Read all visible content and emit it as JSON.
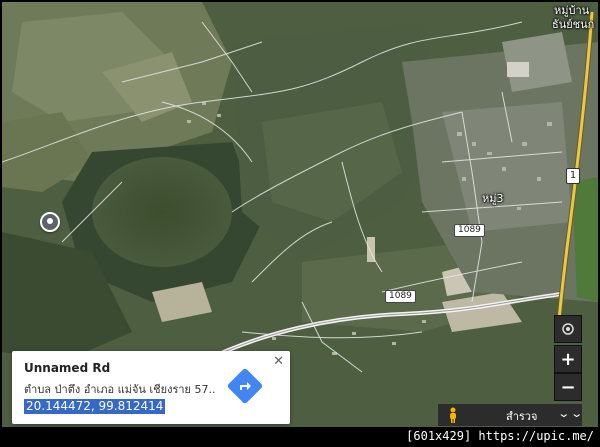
{
  "map": {
    "labels": {
      "village_top_line1": "หมู่บ้าน",
      "village_top_line2": "ธันย์ชนก",
      "moo3": "หมู่3"
    },
    "route_shields": {
      "route_a": "1089",
      "route_b": "1089"
    },
    "highway_marker": "1"
  },
  "info_card": {
    "title": "Unnamed Rd",
    "address": "ตำบล ป่าตึง อำเภอ แม่จัน เชียงราย 57..",
    "coordinates": "20.144472, 99.812414",
    "close_glyph": "✕"
  },
  "controls": {
    "zoom_in": "+",
    "zoom_out": "−",
    "explore_label": "สำรวจ",
    "explore_chevron": "⌄⌄"
  },
  "footer": {
    "watermark": "[601x429] https://upic.me/"
  },
  "colors": {
    "accent": "#4285f4",
    "coordinates_highlight": "#3569c7",
    "control_bg": "#2c2c2c",
    "highway": "#e8c84a"
  }
}
